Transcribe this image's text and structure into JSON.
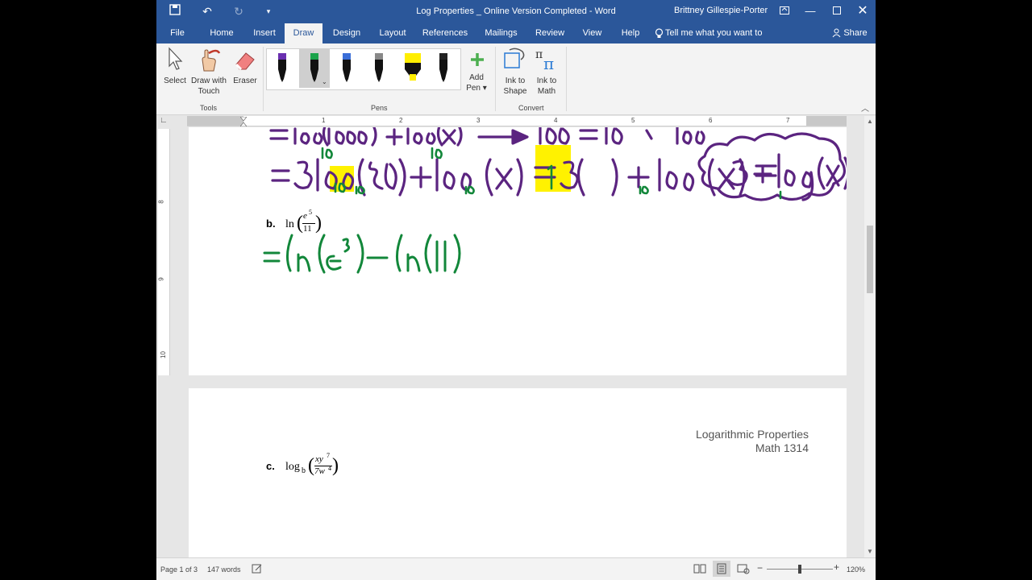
{
  "titlebar": {
    "document_title": "Log Properties _ Online Version Completed  -  Word",
    "user": "Brittney Gillespie-Porter"
  },
  "tabs": [
    "File",
    "Home",
    "Insert",
    "Draw",
    "Design",
    "Layout",
    "References",
    "Mailings",
    "Review",
    "View",
    "Help"
  ],
  "tell_me": "Tell me what you want to do",
  "share": "Share",
  "ribbon": {
    "tools": {
      "select": "Select",
      "draw_touch_1": "Draw with",
      "draw_touch_2": "Touch",
      "eraser": "Eraser",
      "group": "Tools"
    },
    "pens": {
      "group": "Pens",
      "add_pen_1": "Add",
      "add_pen_2": "Pen ▾"
    },
    "convert": {
      "ink_shape_1": "Ink to",
      "ink_shape_2": "Shape",
      "ink_math_1": "Ink to",
      "ink_math_2": "Math",
      "group": "Convert"
    }
  },
  "ruler": {
    "numbers": [
      "1",
      "2",
      "3",
      "4",
      "5",
      "6",
      "7"
    ],
    "vertical": [
      "8",
      "9",
      "10"
    ]
  },
  "document": {
    "page1": {
      "problem_b_label": "b.",
      "problem_b_expr_fn": "ln",
      "problem_b_num": "e",
      "problem_b_exp": "5",
      "problem_b_den": "11"
    },
    "page2": {
      "header_line1": "Logarithmic Properties",
      "header_line2": "Math 1314",
      "problem_c_label": "c.",
      "problem_c_fn": "log",
      "problem_c_base": "b",
      "problem_c_num": "xy",
      "problem_c_num_exp": "7",
      "problem_c_den": "7w",
      "problem_c_den_exp": "4"
    }
  },
  "statusbar": {
    "page": "Page 1 of 3",
    "words": "147 words",
    "zoom": "120%"
  },
  "colors": {
    "title_blue": "#2b579a",
    "ink_purple": "#5b2480",
    "ink_green": "#12873a",
    "highlight": "#fff200"
  }
}
